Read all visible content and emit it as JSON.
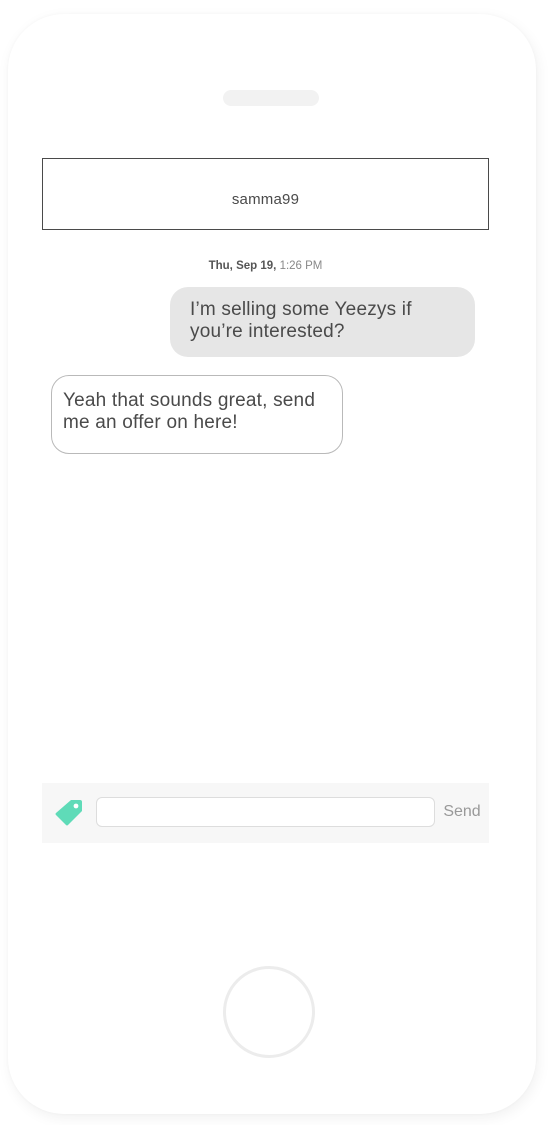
{
  "conversation": {
    "contact_name": "samma99",
    "timestamp_day": "Thu, Sep 19,",
    "timestamp_time": "1:26 PM",
    "messages": [
      {
        "direction": "outgoing",
        "text": "I’m selling some Yeezys if you’re interested?"
      },
      {
        "direction": "incoming",
        "text": "Yeah that sounds great, send me an offer on here!"
      }
    ]
  },
  "composer": {
    "input_value": "",
    "input_placeholder": "",
    "send_label": "Send",
    "offer_icon": "price-tag-icon",
    "offer_icon_color": "#5fdbb8"
  },
  "colors": {
    "outgoing_bubble": "#e6e6e6",
    "incoming_bubble_border": "#b9b9b9",
    "header_border": "#4a4a4a"
  }
}
